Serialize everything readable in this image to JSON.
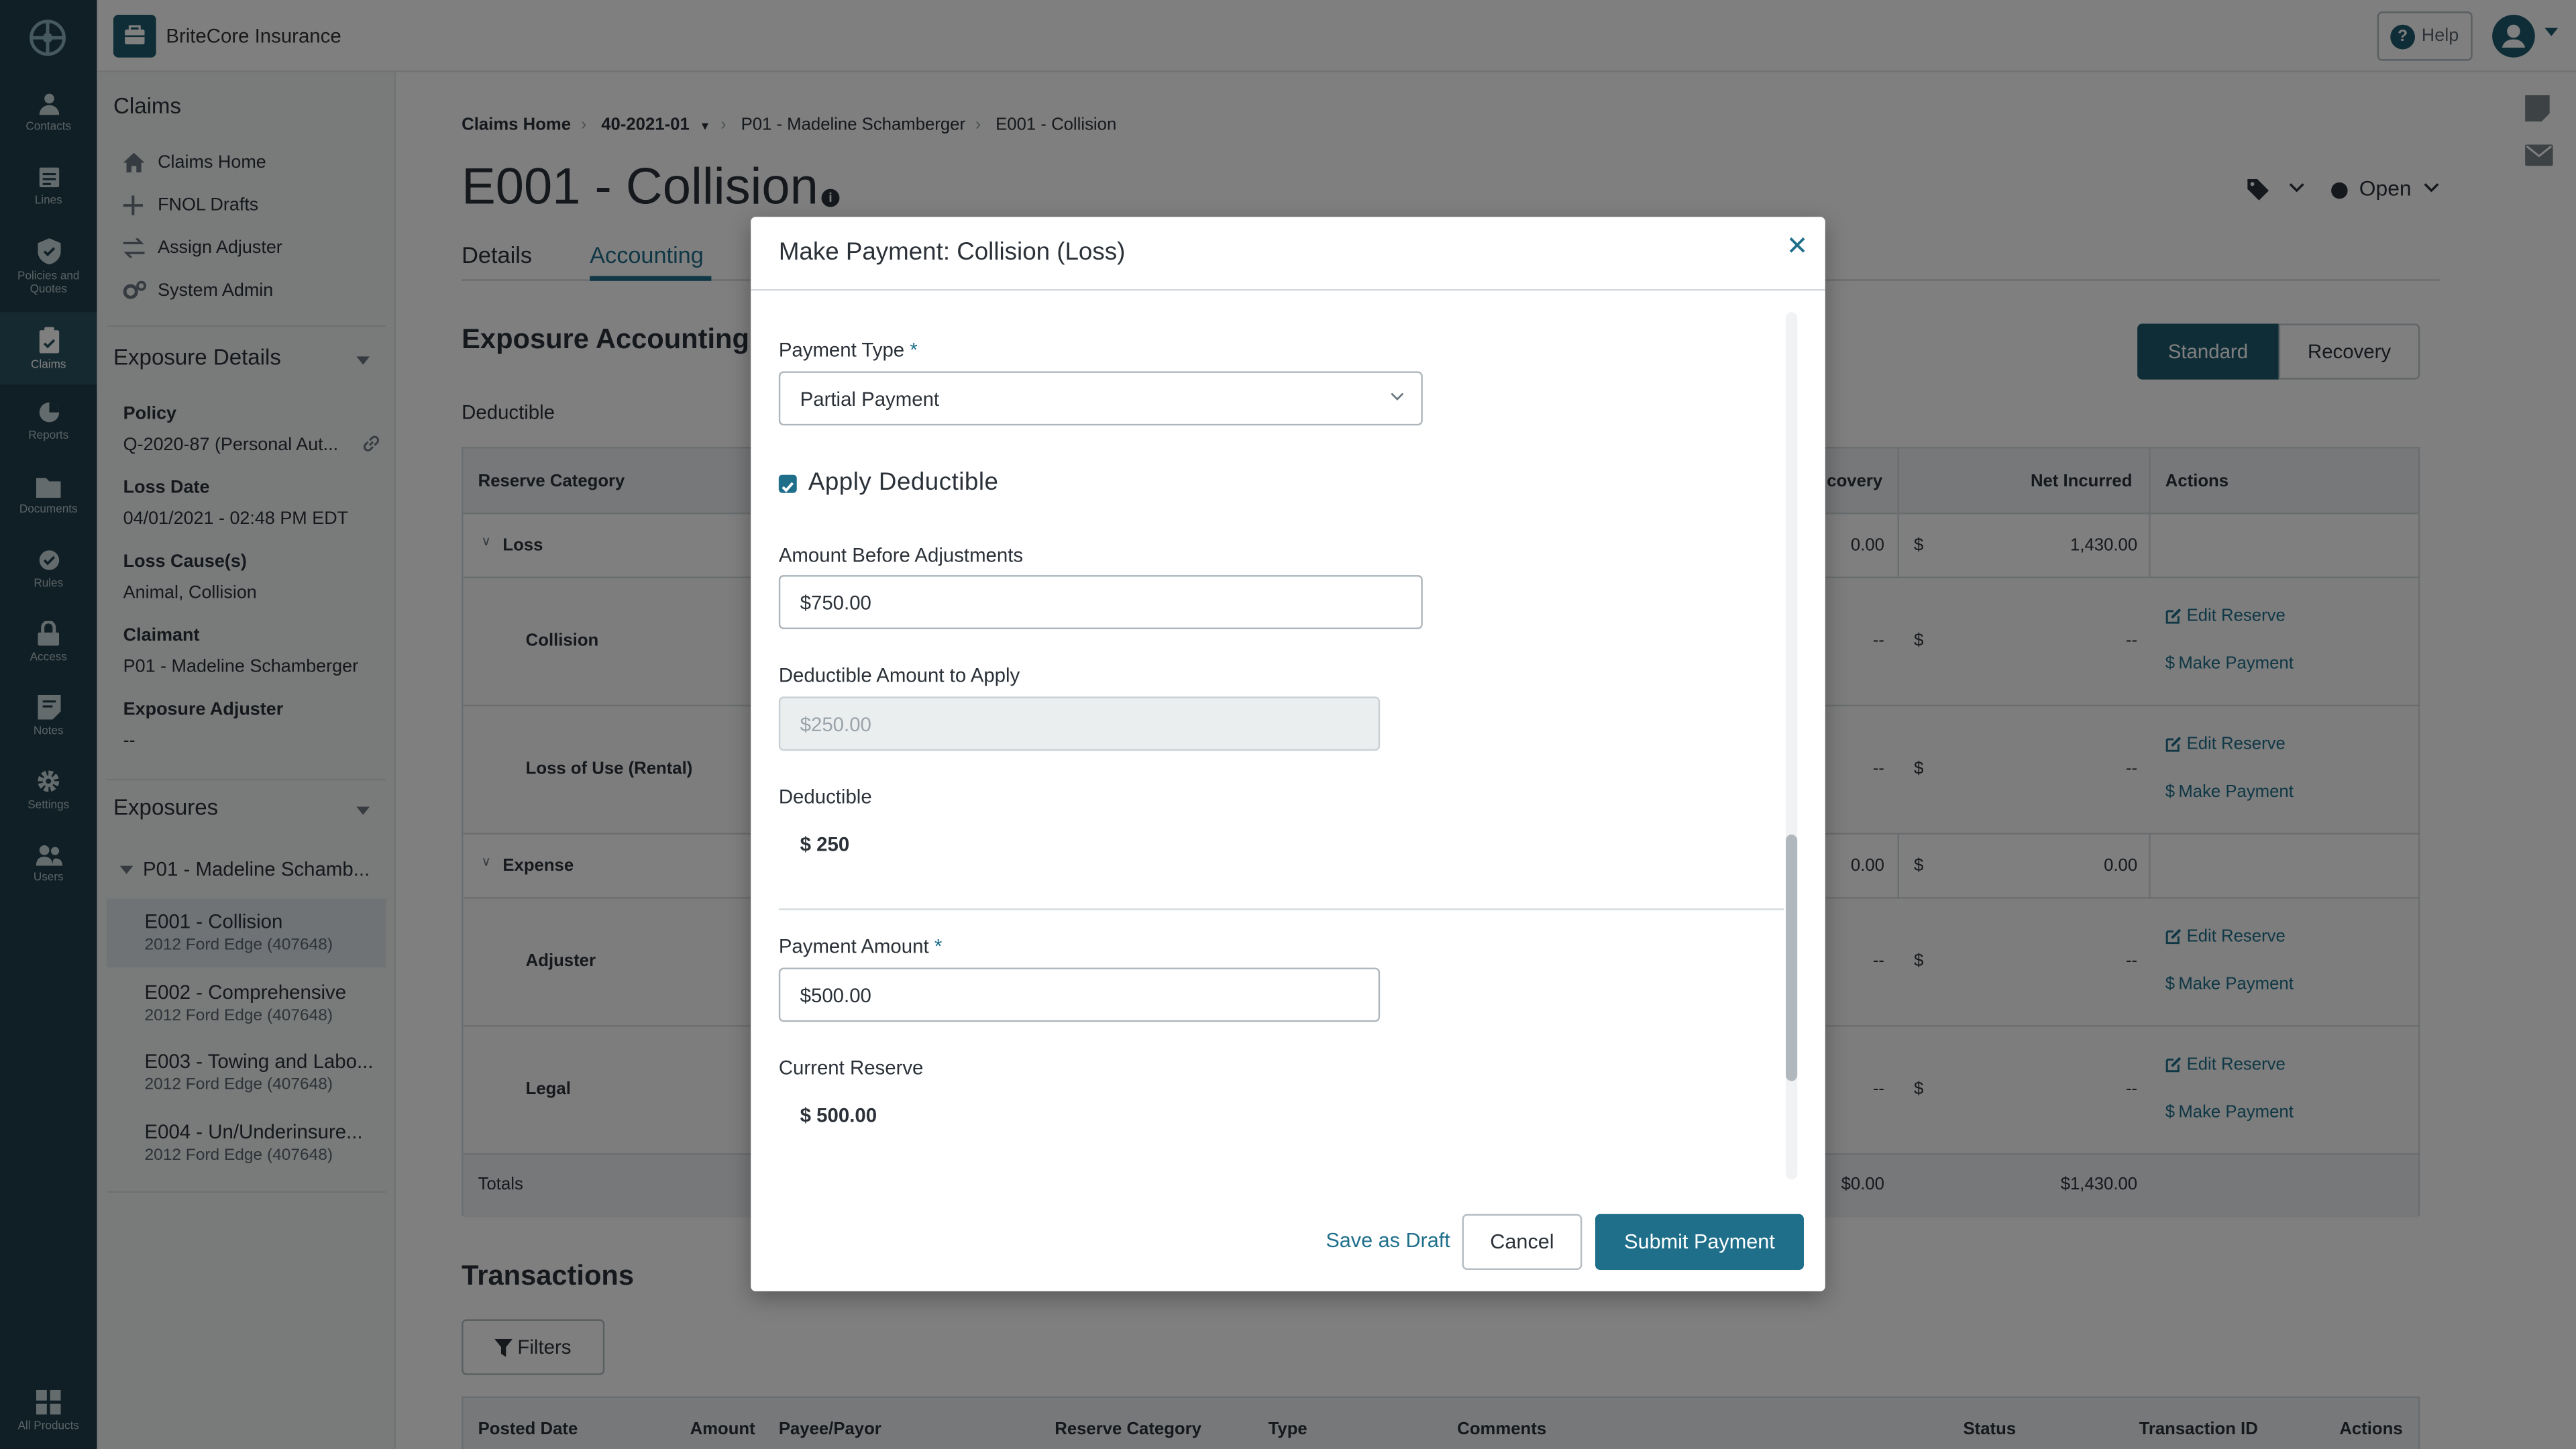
{
  "app": {
    "brand": "BriteCore Insurance",
    "help_label": "Help"
  },
  "rail": {
    "items": [
      {
        "label": "Contacts",
        "icon": "person-icon"
      },
      {
        "label": "Lines",
        "icon": "lines-icon"
      },
      {
        "label": "Policies and Quotes",
        "icon": "shield-icon"
      },
      {
        "label": "Claims",
        "icon": "clipboard-icon"
      },
      {
        "label": "Reports",
        "icon": "pie-chart-icon"
      },
      {
        "label": "Documents",
        "icon": "folder-icon"
      },
      {
        "label": "Rules",
        "icon": "rules-icon"
      },
      {
        "label": "Access",
        "icon": "lock-icon"
      },
      {
        "label": "Notes",
        "icon": "notes-icon"
      },
      {
        "label": "Settings",
        "icon": "gear-icon"
      },
      {
        "label": "Users",
        "icon": "users-icon"
      }
    ],
    "all_products": "All Products"
  },
  "sidebar": {
    "claims_title": "Claims",
    "nav": [
      "Claims Home",
      "FNOL Drafts",
      "Assign Adjuster",
      "System Admin"
    ],
    "exposure_details_title": "Exposure Details",
    "policy_label": "Policy",
    "policy_value": "Q-2020-87 (Personal Aut...",
    "loss_date_label": "Loss Date",
    "loss_date_value": "04/01/2021 - 02:48 PM EDT",
    "loss_cause_label": "Loss Cause(s)",
    "loss_cause_value": "Animal, Collision",
    "claimant_label": "Claimant",
    "claimant_value": "P01 - Madeline Schamberger",
    "adjuster_label": "Exposure Adjuster",
    "adjuster_value": "--",
    "exposures_title": "Exposures",
    "exposure_group": "P01 - Madeline Schamb...",
    "exposures": [
      {
        "title": "E001 - Collision",
        "sub": "2012 Ford Edge (407648)"
      },
      {
        "title": "E002 - Comprehensive",
        "sub": "2012 Ford Edge (407648)"
      },
      {
        "title": "E003 - Towing and Labo...",
        "sub": "2012 Ford Edge (407648)"
      },
      {
        "title": "E004 - Un/Underinsure...",
        "sub": "2012 Ford Edge (407648)"
      }
    ]
  },
  "breadcrumb": [
    "Claims Home",
    "40-2021-01",
    "P01 - Madeline Schamberger",
    "E001 - Collision"
  ],
  "page": {
    "title": "E001 - Collision",
    "status": "Open",
    "tabs": [
      "Details",
      "Accounting"
    ],
    "section_title": "Exposure Accounting",
    "toggle_standard": "Standard",
    "toggle_recovery": "Recovery",
    "deductible_label": "Deductible"
  },
  "table": {
    "headers": {
      "reserve_category": "Reserve Category",
      "recovery": "covery",
      "net_incurred": "Net Incurred",
      "actions": "Actions"
    },
    "rows": [
      {
        "label": "Loss",
        "recovery": "0.00",
        "currency": "$",
        "net": "1,430.00"
      },
      {
        "label": "Collision",
        "recovery": "--",
        "currency": "$",
        "net": "--",
        "edit": "Edit Reserve",
        "pay": "Make Payment"
      },
      {
        "label": "Loss of Use (Rental)",
        "recovery": "--",
        "currency": "$",
        "net": "--",
        "edit": "Edit Reserve",
        "pay": "Make Payment"
      },
      {
        "label": "Expense",
        "recovery": "0.00",
        "currency": "$",
        "net": "0.00"
      },
      {
        "label": "Adjuster",
        "recovery": "--",
        "currency": "$",
        "net": "--",
        "edit": "Edit Reserve",
        "pay": "Make Payment"
      },
      {
        "label": "Legal",
        "recovery": "--",
        "currency": "$",
        "net": "--",
        "edit": "Edit Reserve",
        "pay": "Make Payment"
      }
    ],
    "totals": {
      "label": "Totals",
      "recovery": "$0.00",
      "net": "$1,430.00"
    }
  },
  "transactions": {
    "title": "Transactions",
    "filters": "Filters",
    "headers": [
      "Posted Date",
      "Amount",
      "Payee/Payor",
      "Reserve Category",
      "Type",
      "Comments",
      "Status",
      "Transaction ID",
      "Actions"
    ]
  },
  "modal": {
    "title": "Make Payment: Collision (Loss)",
    "payment_type_label": "Payment Type",
    "payment_type_value": "Partial Payment",
    "apply_deductible": "Apply Deductible",
    "amount_before_label": "Amount Before Adjustments",
    "amount_before_value": "$750.00",
    "deductible_apply_label": "Deductible Amount to Apply",
    "deductible_apply_value": "$250.00",
    "deductible_label": "Deductible",
    "deductible_value": "$ 250",
    "payment_amount_label": "Payment Amount",
    "payment_amount_value": "$500.00",
    "current_reserve_label": "Current Reserve",
    "current_reserve_value": "$ 500.00",
    "required_mark": "*",
    "save_draft": "Save as Draft",
    "cancel": "Cancel",
    "submit": "Submit Payment"
  },
  "colors": {
    "accent": "#1f6f8b",
    "rail": "#1f3e4a",
    "brand": "#1f5a6e"
  }
}
